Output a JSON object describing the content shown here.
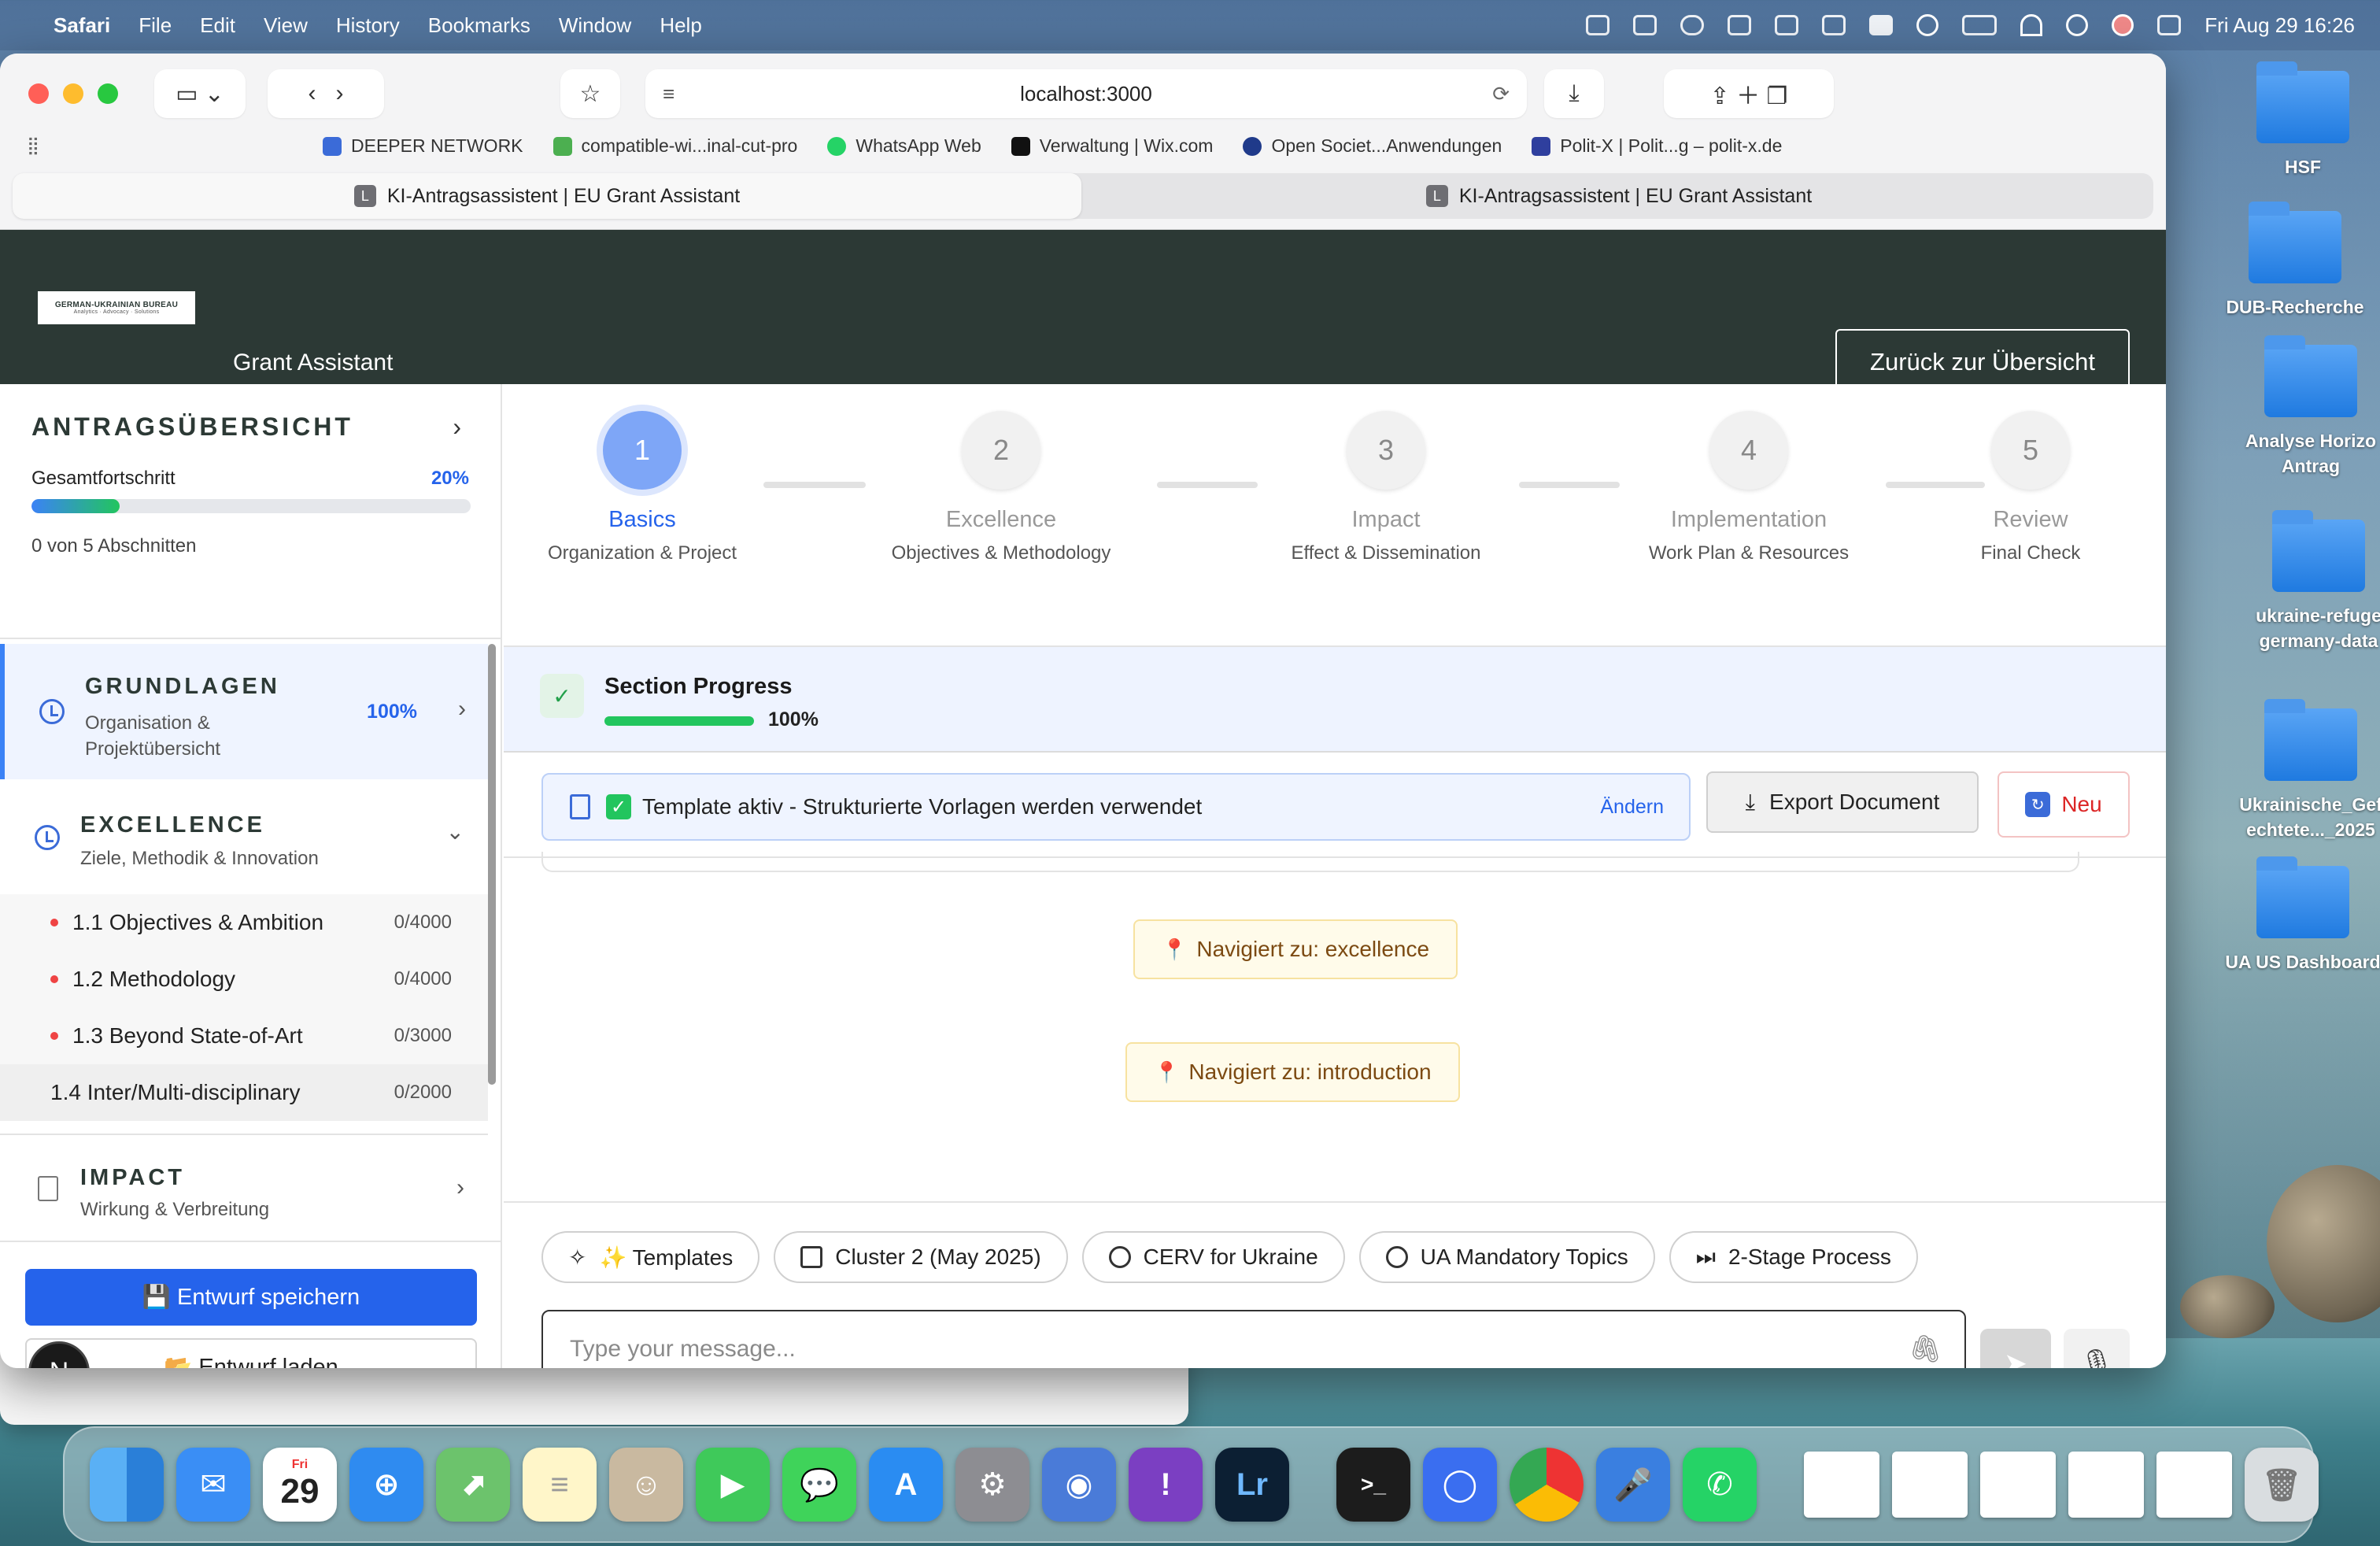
{
  "menubar": {
    "app_name": "Safari",
    "items": [
      "File",
      "Edit",
      "View",
      "History",
      "Bookmarks",
      "Window",
      "Help"
    ],
    "datetime": "Fri Aug 29  16:26"
  },
  "browser": {
    "url": "localhost:3000",
    "favorites": [
      {
        "label": "DEEPER NETWORK",
        "color": "#3b6bd8"
      },
      {
        "label": "compatible-wi...inal-cut-pro",
        "color": "#4caf50"
      },
      {
        "label": "WhatsApp Web",
        "color": "#25d366"
      },
      {
        "label": "Verwaltung | Wix.com",
        "color": "#111111"
      },
      {
        "label": "Open Societ...Anwendungen",
        "color": "#1f3a8a"
      },
      {
        "label": "Polit-X | Polit...g – polit-x.de",
        "color": "#2f3f9e"
      }
    ],
    "tabs": [
      {
        "label": "KI-Antragsassistent | EU Grant Assistant",
        "icon": "L"
      },
      {
        "label": "KI-Antragsassistent | EU Grant Assistant",
        "icon": "L"
      }
    ]
  },
  "header": {
    "logo_text": "GERMAN-UKRAINIAN BUREAU",
    "logo_tagline": "Analytics · Advocacy · Solutions",
    "subtitle": "Grant Assistant",
    "back_button": "Zurück zur Übersicht"
  },
  "sidebar": {
    "title": "ANTRAGSÜBERSICHT",
    "progress_label": "Gesamtfortschritt",
    "progress_value": "20%",
    "progress_fraction": 0.2,
    "sections_count": "0 von 5 Abschnitten",
    "sections": {
      "grundlagen": {
        "title": "GRUNDLAGEN",
        "sub1": "Organisation &",
        "sub2": "Projektübersicht",
        "percent": "100%"
      },
      "excellence": {
        "title": "EXCELLENCE",
        "sub": "Ziele, Methodik & Innovation"
      },
      "impact": {
        "title": "IMPACT",
        "sub": "Wirkung & Verbreitung"
      }
    },
    "subitems": [
      {
        "label": "1.1 Objectives & Ambition",
        "count": "0/4000"
      },
      {
        "label": "1.2 Methodology",
        "count": "0/4000"
      },
      {
        "label": "1.3 Beyond State-of-Art",
        "count": "0/3000"
      },
      {
        "label": "1.4 Inter/Multi-disciplinary",
        "count": "0/2000"
      }
    ],
    "save_button": "💾 Entwurf speichern",
    "load_button": "📂 Entwurf laden",
    "avatar_letter": "N"
  },
  "stepper": [
    {
      "num": "1",
      "label": "Basics",
      "sub": "Organization & Project"
    },
    {
      "num": "2",
      "label": "Excellence",
      "sub": "Objectives & Methodology"
    },
    {
      "num": "3",
      "label": "Impact",
      "sub": "Effect & Dissemination"
    },
    {
      "num": "4",
      "label": "Implementation",
      "sub": "Work Plan & Resources"
    },
    {
      "num": "5",
      "label": "Review",
      "sub": "Final Check"
    }
  ],
  "section_progress": {
    "title": "Section Progress",
    "value": "100%",
    "fraction": 1.0
  },
  "template_banner": {
    "text": "Template aktiv - Strukturierte Vorlagen werden verwendet",
    "change": "Ändern",
    "export_button": "Export Document",
    "new_button": "Neu"
  },
  "chat": {
    "messages": [
      "Navigiert zu: excellence",
      "Navigiert zu: introduction"
    ],
    "chips": [
      "✨ Templates",
      "Cluster 2 (May 2025)",
      "CERV for Ukraine",
      "UA Mandatory Topics",
      "2-Stage Process"
    ],
    "input_placeholder": "Type your message..."
  },
  "desktop": {
    "folders": [
      "HSF",
      "DUB-Recherche",
      "Analyse Horizo Antrag",
      "ukraine-refuge germany-data",
      "Ukrainische_Gef echtete..._2025",
      "UA US Dashboard"
    ]
  },
  "dock": {
    "calendar_month": "Fri",
    "calendar_day": "29"
  }
}
